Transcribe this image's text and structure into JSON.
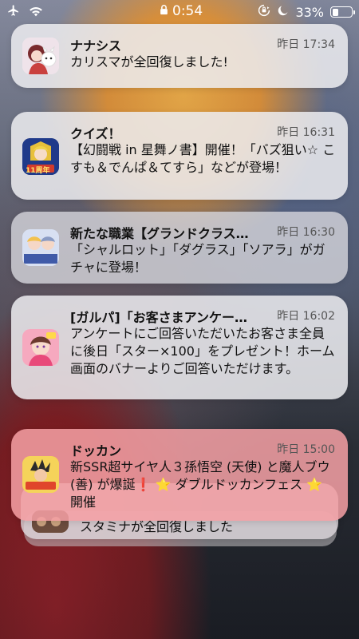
{
  "status_bar": {
    "time": "0:54",
    "battery_percent": "33%",
    "battery_level": 0.33,
    "icons": [
      "airplane-icon",
      "wifi-icon",
      "lock-icon",
      "moon-icon",
      "orientation-lock-icon"
    ]
  },
  "notifications": [
    {
      "app": "ナナシス",
      "time": "昨日 17:34",
      "body": "カリスマが全回復しました!"
    },
    {
      "app": "クイズ！",
      "time": "昨日 16:31",
      "body": "【幻闘戦 in 星舞ノ書】開催！「バズ狙い☆ こすも＆でんぱ＆てすら」などが登場！",
      "icon_text": "11周年"
    },
    {
      "app": "新たな職業【グランドクラス…",
      "time": "昨日 16:30",
      "body": "「シャルロット」「ダグラス」「ソアラ」がガチャに登場！"
    },
    {
      "app": "[ガルパ]「お客さまアンケー…",
      "time": "昨日 16:02",
      "body": "アンケートにご回答いただいたお客さま全員に後日「スター×100」をプレゼント！ホーム画面のバナーよりご回答いただけます。"
    },
    {
      "app": "ドッカン",
      "time": "昨日 15:00",
      "body": "新SSR超サイヤ人３孫悟空 (天使) と魔人ブウ (善) が爆誕❗️ ⭐ ダブルドッカンフェス ⭐ 開催"
    }
  ],
  "stacked_notification": {
    "body": "スタミナが全回復しました"
  }
}
